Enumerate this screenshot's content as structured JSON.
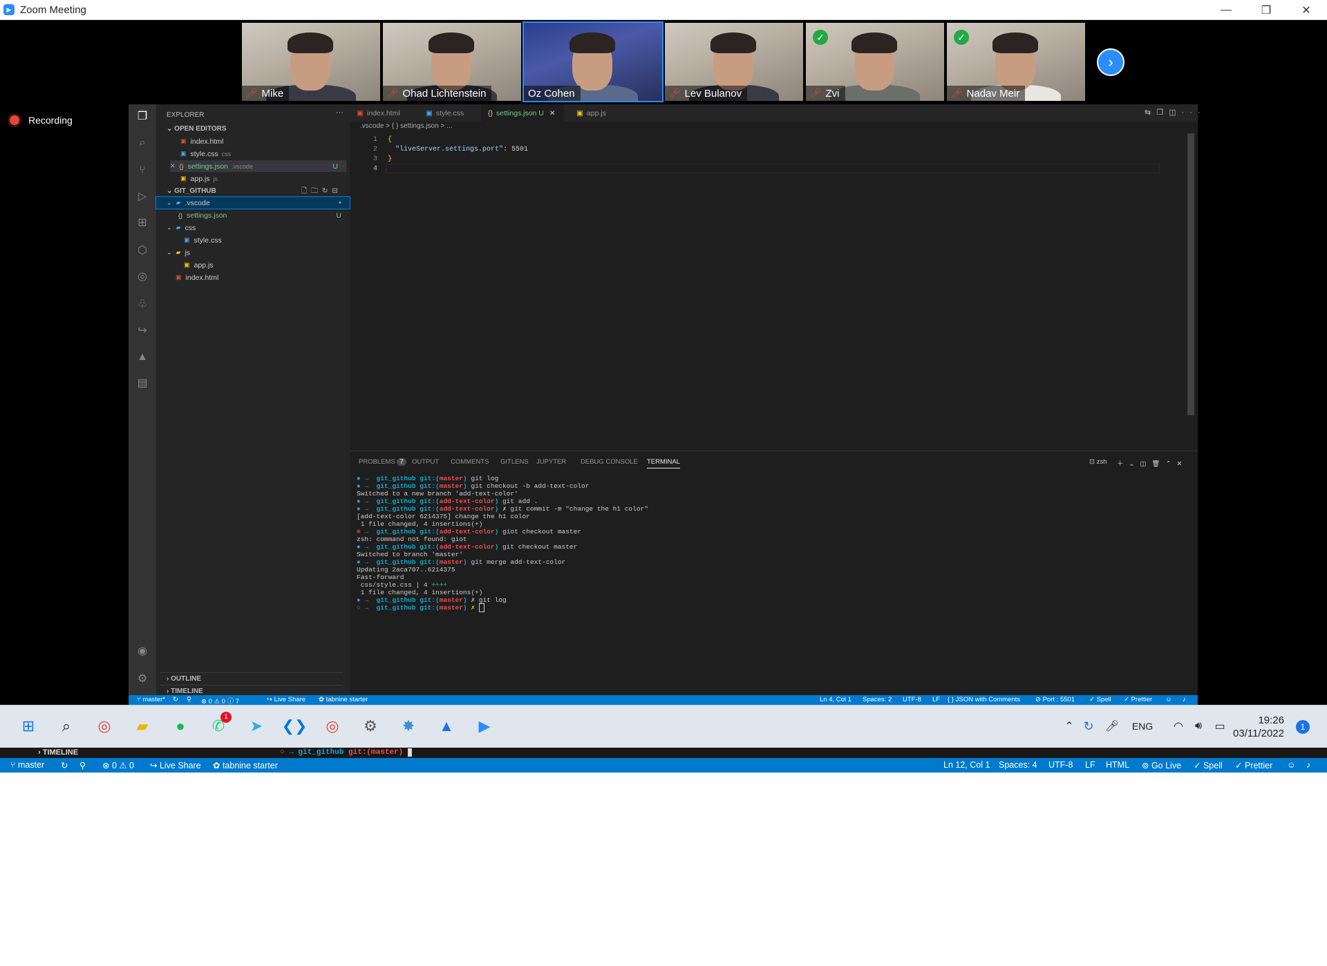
{
  "window": {
    "title": "Zoom Meeting"
  },
  "participants": [
    {
      "name": "Mike",
      "verified": false,
      "active": false
    },
    {
      "name": "Ohad Lichtenstein",
      "verified": false,
      "active": false
    },
    {
      "name": "Oz Cohen",
      "verified": false,
      "active": true
    },
    {
      "name": "Lev Bulanov",
      "verified": false,
      "active": false
    },
    {
      "name": "Zvi",
      "verified": true,
      "active": false
    },
    {
      "name": "Nadav Meir",
      "verified": true,
      "active": false
    }
  ],
  "recording": {
    "label": "Recording"
  },
  "explorer": {
    "title": "EXPLORER",
    "open_editors_title": "OPEN EDITORS",
    "open_editors": [
      {
        "name": "index.html",
        "suffix": ""
      },
      {
        "name": "style.css",
        "suffix": "css"
      },
      {
        "name": "settings.json",
        "suffix": ".vscode",
        "badge": "U"
      },
      {
        "name": "app.js",
        "suffix": "js"
      }
    ],
    "project_title": "GIT_GITHUB",
    "tree": [
      {
        "name": ".vscode",
        "badge": "●"
      },
      {
        "name": "settings.json",
        "badge": "U"
      },
      {
        "name": "css"
      },
      {
        "name": "style.css"
      },
      {
        "name": "js"
      },
      {
        "name": "app.js"
      },
      {
        "name": "index.html"
      }
    ],
    "outline": "OUTLINE",
    "timeline": "TIMELINE"
  },
  "tabs": [
    {
      "label": "index.html"
    },
    {
      "label": "style.css"
    },
    {
      "label": "settings.json U"
    },
    {
      "label": "app.js"
    }
  ],
  "breadcrumb": ".vscode > { } settings.json > ...",
  "code": {
    "lines": [
      "1",
      "2",
      "3",
      "4"
    ],
    "l1": "{",
    "l2_key": "\"liveServer.settings.port\"",
    "l2_rest": ": 5501",
    "l3": "}"
  },
  "panel": {
    "tabs": [
      "PROBLEMS",
      "OUTPUT",
      "COMMENTS",
      "GITLENS",
      "JUPYTER",
      "DEBUG CONSOLE",
      "TERMINAL"
    ],
    "problems_count": "7",
    "shell": "zsh"
  },
  "terminal": {
    "prompt_dir": "git_github",
    "l1_cmd": "git log",
    "l2_cmd": "git checkout -b add-text-color",
    "l3": "Switched to a new branch 'add-text-color'",
    "l4_cmd": "git add .",
    "l5_cmd": "✗ git commit -m \"change the h1 color\"",
    "l6": "[add-text-color 6214375] change the h1 color",
    "l7": " 1 file changed, 4 insertions(+)",
    "l8_cmd": "giot checkout master",
    "l9": "zsh: command not found: giot",
    "l10_cmd": "git checkout master",
    "l11": "Switched to branch 'master'",
    "l12_cmd": "git merge add-text-color",
    "l13": "Updating 2aca707..6214375",
    "l14": "Fast-forward",
    "l15a": " css/style.css | 4 ",
    "l15b": "++++",
    "l16": " 1 file changed, 4 insertions(+)",
    "l17_cmd": "✗ git log",
    "l18_cmd": "✗ "
  },
  "inner_status": {
    "branch": "master*",
    "problems": "⊗ 0 ⚠ 0 ⓘ 7",
    "liveshare": "Live Share",
    "tabnine": "tabnine starter",
    "pos": "Ln 4, Col 1",
    "spaces": "Spaces: 2",
    "enc": "UTF-8",
    "eol": "LF",
    "lang": "{ } JSON with Comments",
    "port": "⊘ Port : 5501",
    "spell": "✓ Spell",
    "prettier": "✓ Prettier"
  },
  "taskbar": {
    "lang": "ENG",
    "time": "19:26",
    "date": "03/11/2022",
    "notif": "1",
    "whatsapp_badge": "1"
  },
  "strip": {
    "timeline": "TIMELINE",
    "prompt_dir": "git_github",
    "prompt_git": "git:(master)"
  },
  "outer_status": {
    "branch": "master",
    "problems": "⊗ 0 ⚠ 0",
    "liveshare": "Live Share",
    "tabnine": "tabnine starter",
    "pos": "Ln 12, Col 1",
    "spaces": "Spaces: 4",
    "enc": "UTF-8",
    "eol": "LF",
    "lang": "HTML",
    "golive": "Go Live",
    "spell": "Spell",
    "prettier": "Prettier"
  }
}
